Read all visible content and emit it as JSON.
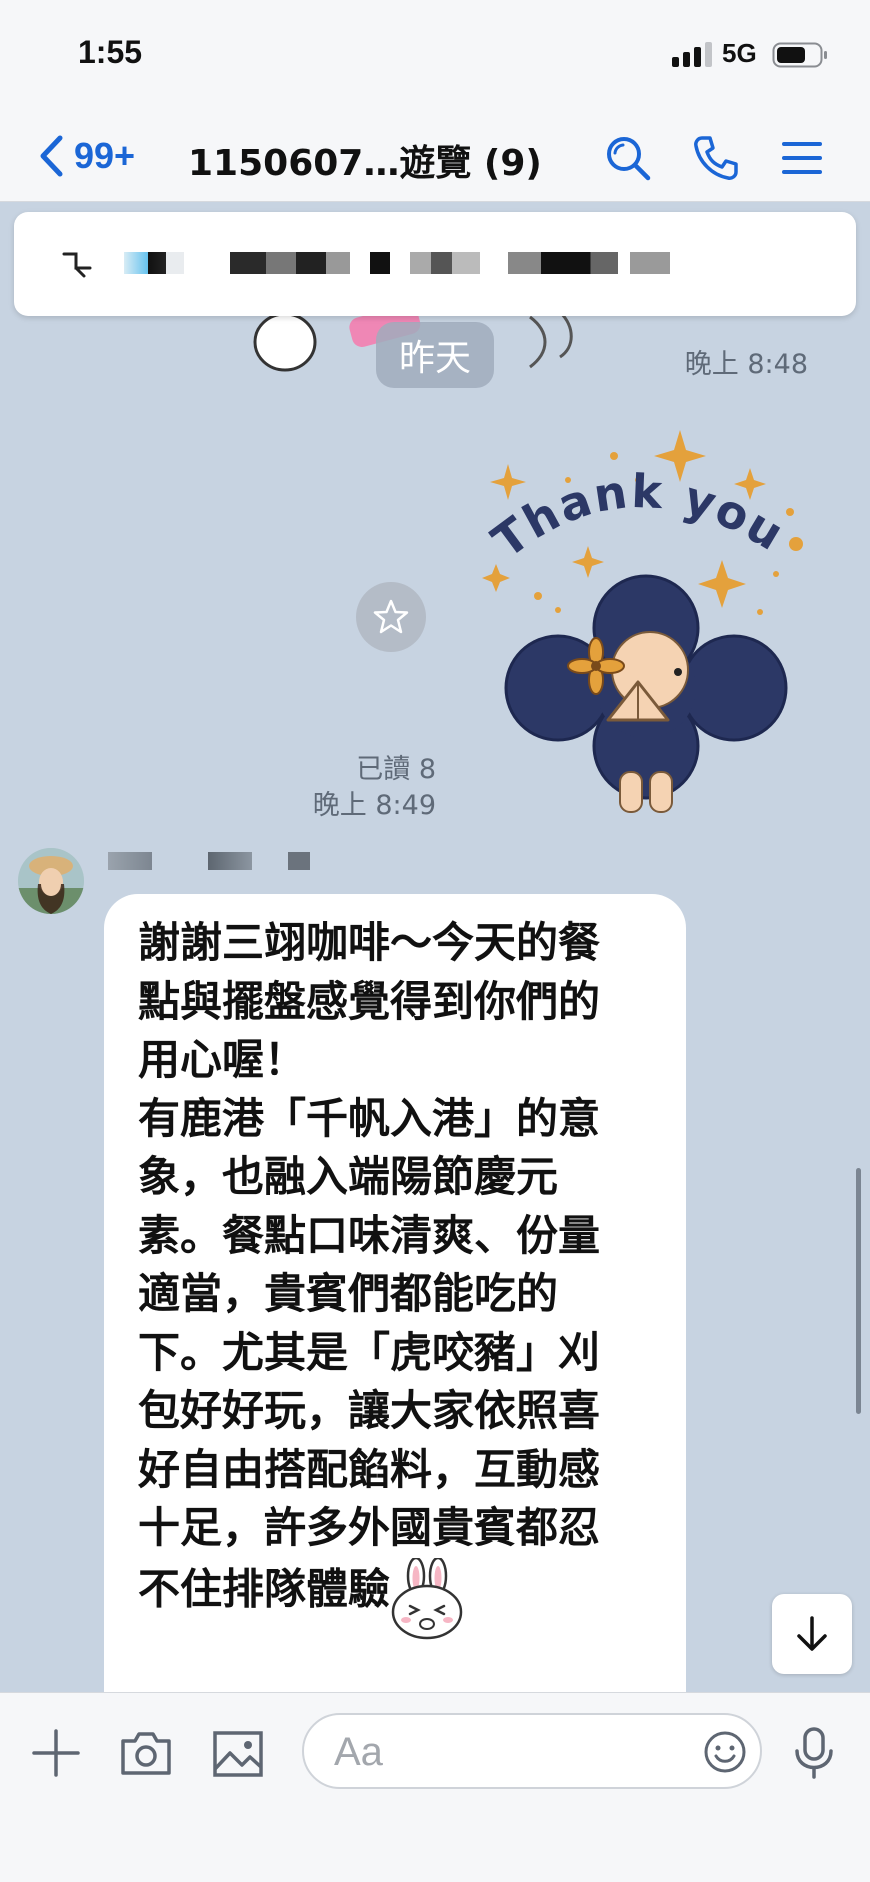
{
  "status_bar": {
    "time": "1:55",
    "network": "5G"
  },
  "header": {
    "back_count": "99+",
    "title": "1150607…遊覽 (9)"
  },
  "messages": {
    "date_chip": "昨天",
    "earlier_sticker_time": "晚上 8:48",
    "read_receipt": "已讀 8",
    "sticker_time": "晚上 8:49",
    "sticker_caption": "Thank you",
    "incoming_text": "謝謝三翊咖啡～今天的餐\n點與擺盤感覺得到你們的\n用心喔！\n有鹿港「千帆入港」的意\n象，也融入端陽節慶元\n素。餐點口味清爽、份量\n適當，貴賓們都能吃的\n下。尤其是「虎咬豬」刈\n包好好玩，讓大家依照喜\n好自由搭配餡料，互動感\n十足，許多外國貴賓都忍\n不住排隊體驗"
  },
  "input": {
    "placeholder": "Aa"
  },
  "colors": {
    "accent": "#1b66d6",
    "chat_background": "#c7d3e1",
    "sticker_navy": "#2c3866",
    "sticker_gold": "#e4a13c"
  },
  "icons": [
    "back-chevron-icon",
    "search-icon",
    "phone-icon",
    "menu-icon",
    "pin-icon",
    "star-icon",
    "arrow-down-icon",
    "plus-icon",
    "camera-icon",
    "image-icon",
    "emoji-icon",
    "microphone-icon"
  ]
}
